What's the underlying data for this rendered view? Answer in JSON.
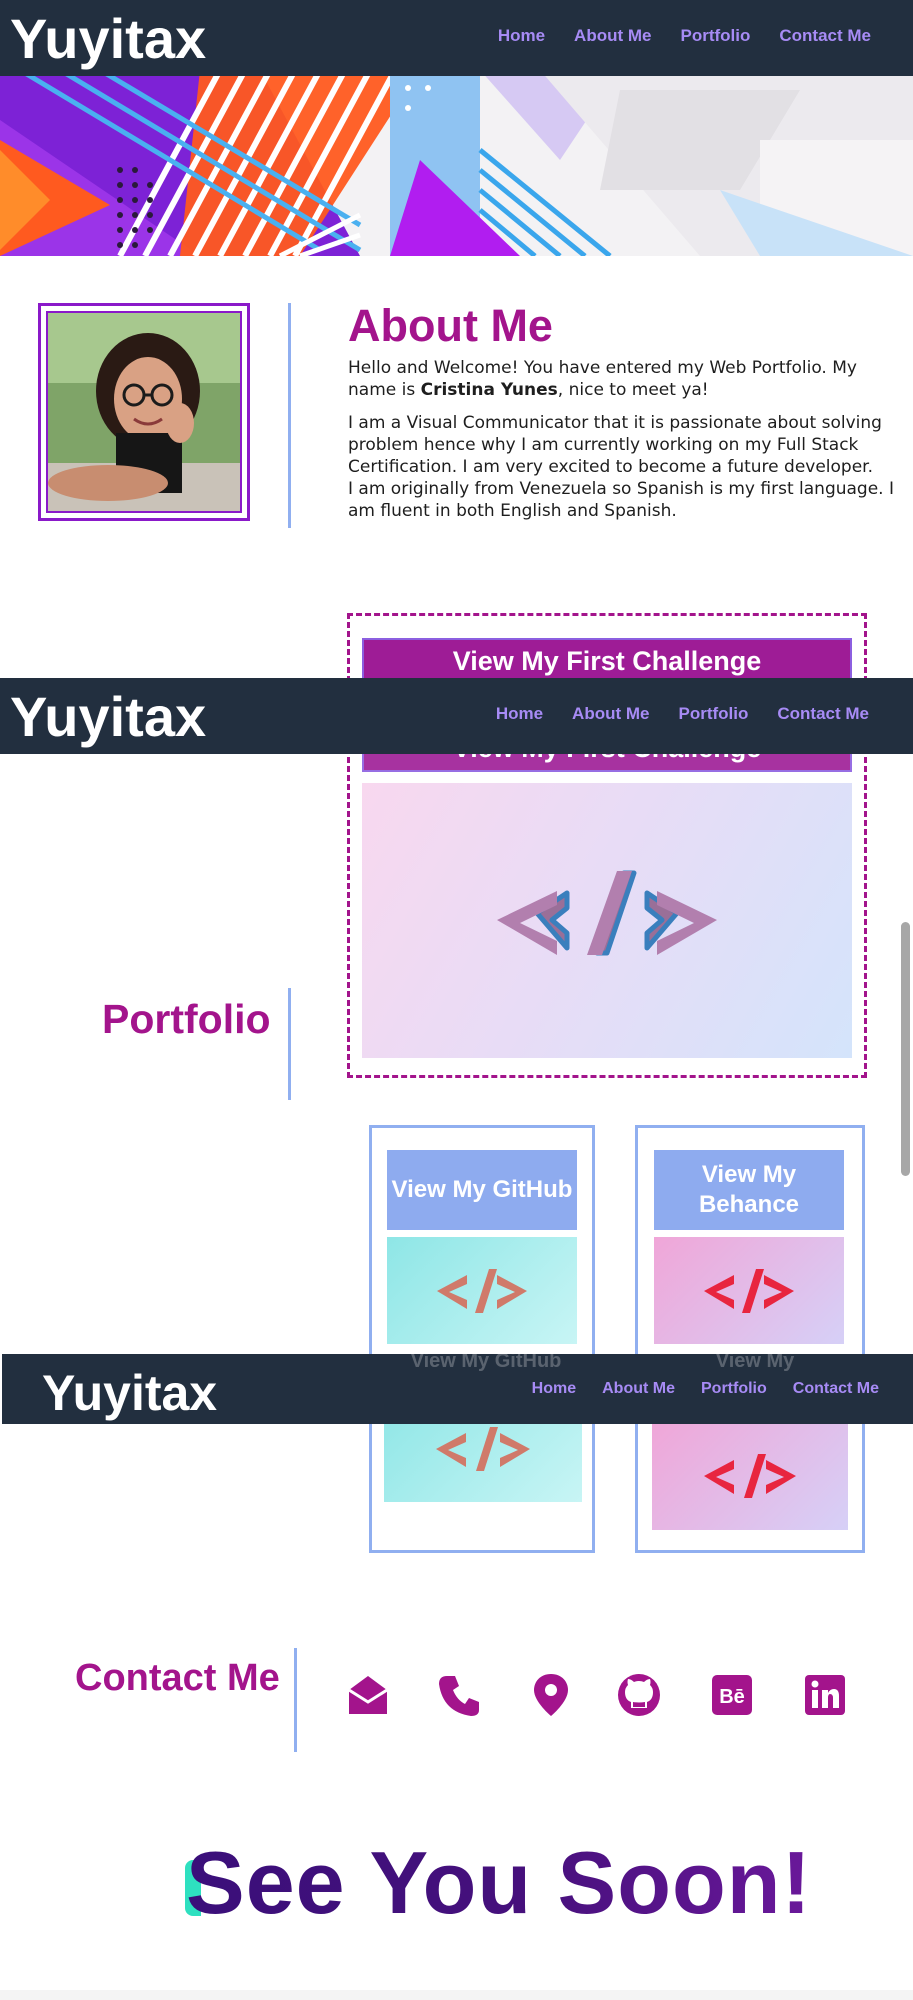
{
  "site": {
    "logo": "Yuyitax",
    "nav": [
      "Home",
      "About Me",
      "Portfolio",
      "Contact Me"
    ]
  },
  "about": {
    "title": "About Me",
    "intro_before": "Hello and Welcome! You have entered my Web Portfolio. My name is ",
    "intro_name": "Cristina Yunes",
    "intro_after": ", nice to meet ya!",
    "paragraph2_line1": "I am a Visual Communicator that it is passionate about solving problem hence why I am currently working on my Full Stack Certification. I am very excited to become a future developer.",
    "paragraph2_line2": "I am originally from Venezuela so Spanish is my first language. I am fluent in both English and Spanish."
  },
  "portfolio": {
    "title": "Portfolio",
    "challenge_label": "View My First Challenge",
    "github_label": "View My GitHub",
    "behance_label": "View My Behance",
    "github_ghost_label": "View My GitHub",
    "behance_ghost_label": "View My"
  },
  "contact": {
    "title": "Contact Me",
    "icons": [
      "envelope-open-icon",
      "phone-icon",
      "location-pin-icon",
      "github-icon",
      "behance-icon",
      "linkedin-icon"
    ]
  },
  "closing": {
    "text": "See You Soon!"
  },
  "colors": {
    "header_bg": "#222f3f",
    "nav_link": "#a78bf5",
    "accent_magenta": "#a3148c",
    "accent_blue": "#90aff0",
    "closing_gradient_start": "#3a0f7a",
    "closing_gradient_end": "#6a189a"
  }
}
